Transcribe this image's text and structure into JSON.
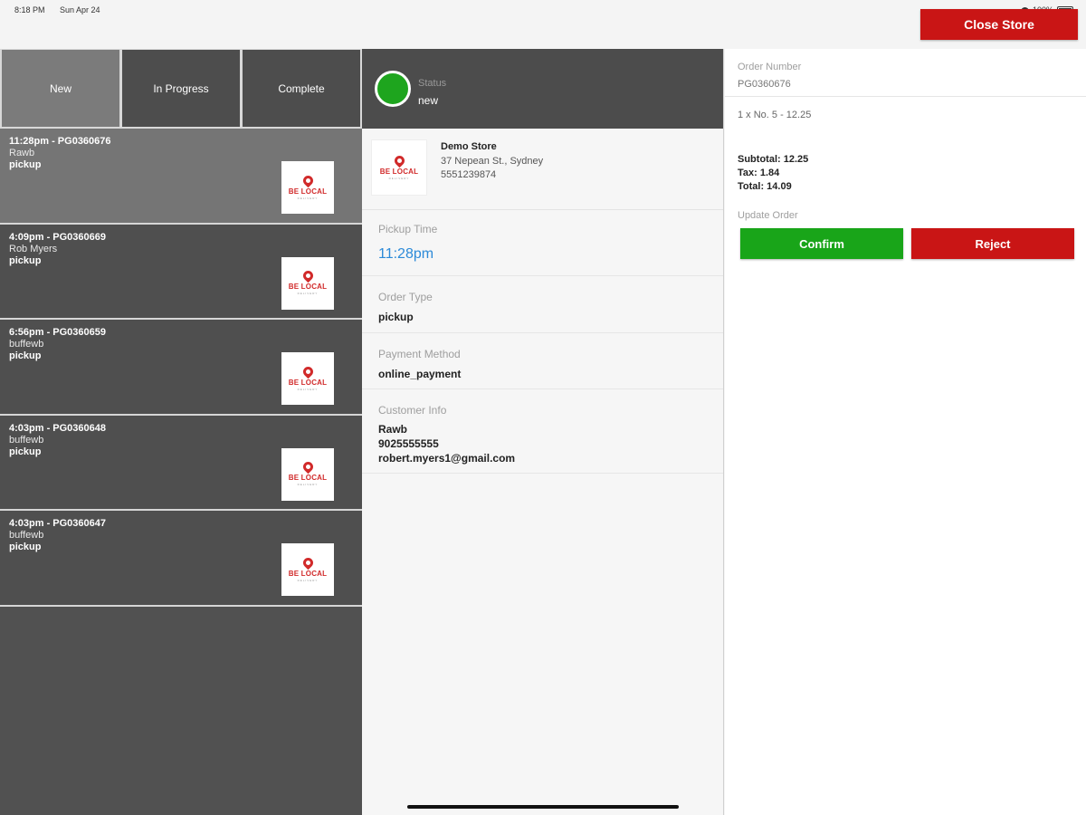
{
  "status_bar": {
    "time": "8:18 PM",
    "date": "Sun Apr 24",
    "battery": "100%"
  },
  "header": {
    "close_store_label": "Close Store"
  },
  "tabs": [
    {
      "label": "New",
      "active": true
    },
    {
      "label": "In Progress",
      "active": false
    },
    {
      "label": "Complete",
      "active": false
    }
  ],
  "orders": [
    {
      "title": "11:28pm - PG0360676",
      "customer": "Rawb",
      "type": "pickup",
      "selected": true,
      "logo_text": "BE LOCAL",
      "logo_sub": "DELIVERY"
    },
    {
      "title": "4:09pm - PG0360669",
      "customer": "Rob Myers",
      "type": "pickup",
      "selected": false,
      "logo_text": "BE LOCAL",
      "logo_sub": "DELIVERY"
    },
    {
      "title": "6:56pm - PG0360659",
      "customer": "buffewb",
      "type": "pickup",
      "selected": false,
      "logo_text": "BE LOCAL",
      "logo_sub": "DELIVERY"
    },
    {
      "title": "4:03pm - PG0360648",
      "customer": "buffewb",
      "type": "pickup",
      "selected": false,
      "logo_text": "BE LOCAL",
      "logo_sub": "DELIVERY"
    },
    {
      "title": "4:03pm - PG0360647",
      "customer": "buffewb",
      "type": "pickup",
      "selected": false,
      "logo_text": "BE LOCAL",
      "logo_sub": "DELIVERY"
    }
  ],
  "detail": {
    "status_label": "Status",
    "status_value": "new",
    "status_color": "#1ea51e",
    "store": {
      "name": "Demo Store",
      "address": "37 Nepean St., Sydney",
      "phone": "5551239874",
      "logo_text": "BE LOCAL",
      "logo_sub": "DELIVERY"
    },
    "pickup_time_label": "Pickup Time",
    "pickup_time": "11:28pm",
    "order_type_label": "Order Type",
    "order_type": "pickup",
    "payment_method_label": "Payment Method",
    "payment_method": "online_payment",
    "customer_info_label": "Customer Info",
    "customer_name": "Rawb",
    "customer_phone": "9025555555",
    "customer_email": "robert.myers1@gmail.com"
  },
  "summary": {
    "order_number_label": "Order Number",
    "order_number": "PG0360676",
    "line_item": "1 x No. 5 - 12.25",
    "subtotal": "Subtotal: 12.25",
    "tax": "Tax: 1.84",
    "total": "Total: 14.09",
    "update_label": "Update Order",
    "confirm_label": "Confirm",
    "reject_label": "Reject"
  },
  "colors": {
    "accent_red": "#c91515",
    "confirm_green": "#19a519",
    "link_blue": "#2c8ad8"
  }
}
